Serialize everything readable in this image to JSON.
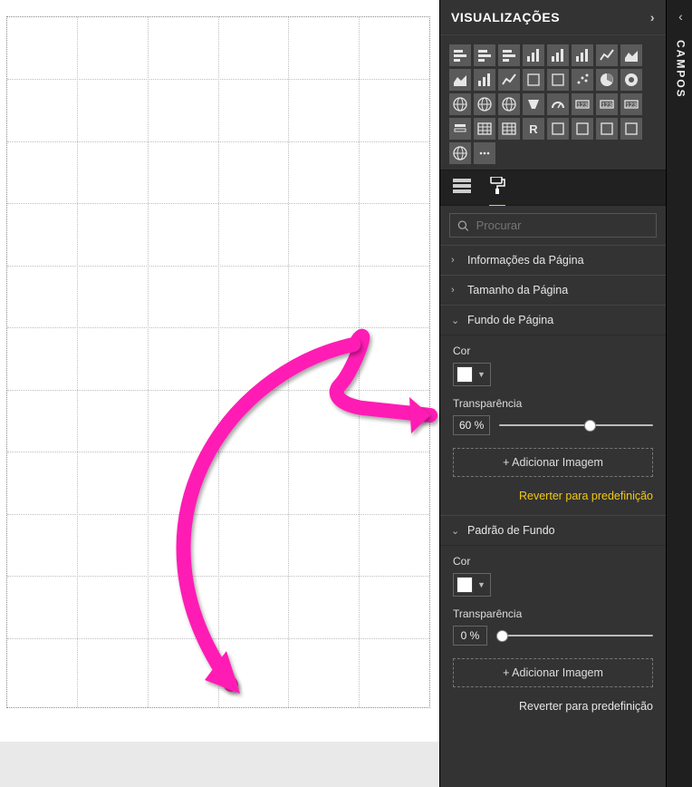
{
  "panel_viz_title": "VISUALIZAÇÕES",
  "panel_campos_title": "CAMPOS",
  "search_placeholder": "Procurar",
  "sections": {
    "pageInfo": "Informações da Página",
    "pageSize": "Tamanho da Página",
    "pageBg": "Fundo de Página",
    "bgPattern": "Padrão de Fundo"
  },
  "labels": {
    "color": "Cor",
    "transparency": "Transparência",
    "addImage": "+ Adicionar Imagem",
    "revert": "Reverter para predefinição"
  },
  "pageBg": {
    "color": "#ffffff",
    "transparency_value": 60,
    "transparency_display": "60 %"
  },
  "bgPattern": {
    "color": "#ffffff",
    "transparency_value": 0,
    "transparency_display": "0 %"
  },
  "viz_icons": [
    "stacked-bar",
    "clustered-bar",
    "stacked-bar-100",
    "clustered-column",
    "stacked-column",
    "stacked-column-100",
    "line",
    "area",
    "stacked-area",
    "line-clustered",
    "line-stacked",
    "ribbon",
    "waterfall",
    "scatter",
    "pie",
    "donut",
    "treemap",
    "map",
    "filled-map",
    "funnel",
    "gauge",
    "card",
    "multi-row-card",
    "kpi",
    "slicer",
    "table",
    "matrix",
    "r-visual",
    "python-visual",
    "key-influencers",
    "decomposition",
    "qna",
    "arc-gis",
    "more"
  ],
  "annotation_color": "#ff1fb4"
}
